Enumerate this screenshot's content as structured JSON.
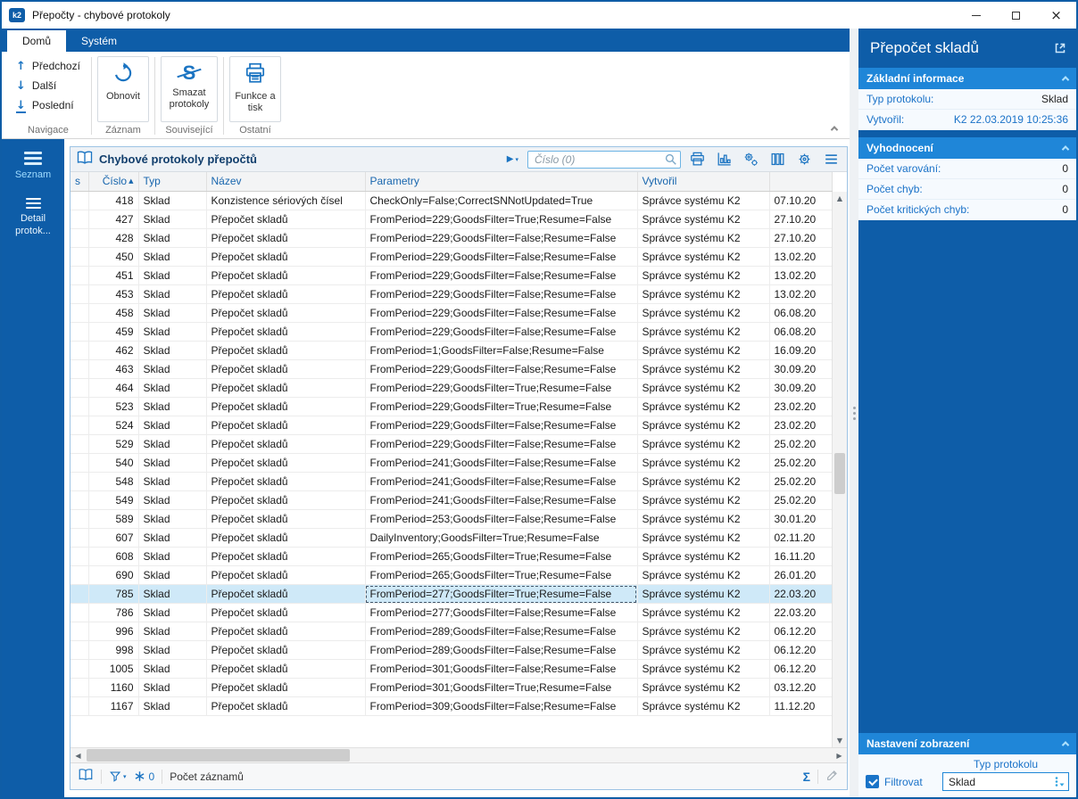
{
  "window": {
    "title": "Přepočty - chybové protokoly",
    "app_badge": "k2"
  },
  "glyphs": {
    "minimize": "",
    "close": "×",
    "play": "▶",
    "caret_down": "▾",
    "up": "↑",
    "down": "↓",
    "sort_asc": "▲",
    "scroll_up": "▲",
    "scroll_down": "▼",
    "scroll_left": "◀",
    "scroll_right": "▶",
    "sigma": "Σ"
  },
  "ribbon": {
    "tabs": [
      {
        "label": "Domů"
      },
      {
        "label": "Systém"
      }
    ],
    "nav": [
      {
        "label": "Předchozí"
      },
      {
        "label": "Další"
      },
      {
        "label": "Poslední"
      }
    ],
    "refresh_label": "Obnovit",
    "delete_label": "Smazat protokoly",
    "functions_label": "Funkce a tisk",
    "group_labels": [
      "Navigace",
      "Záznam",
      "Související",
      "Ostatní"
    ]
  },
  "sidebar": {
    "items": [
      {
        "label": "Seznam"
      },
      {
        "label": "Detail protok..."
      }
    ]
  },
  "main": {
    "title": "Chybové protokoly přepočtů",
    "search_placeholder": "Číslo (0)",
    "columns": {
      "s": "s",
      "cislo": "Číslo",
      "typ": "Typ",
      "nazev": "Název",
      "parametry": "Parametry",
      "vytvoril": "Vytvořil",
      "last": ""
    },
    "selected_num": "785",
    "rows": [
      [
        "418",
        "Sklad",
        "Konzistence sériových čísel",
        "CheckOnly=False;CorrectSNNotUpdated=True",
        "Správce systému K2",
        "07.10.20"
      ],
      [
        "427",
        "Sklad",
        "Přepočet skladů",
        "FromPeriod=229;GoodsFilter=True;Resume=False",
        "Správce systému K2",
        "27.10.20"
      ],
      [
        "428",
        "Sklad",
        "Přepočet skladů",
        "FromPeriod=229;GoodsFilter=False;Resume=False",
        "Správce systému K2",
        "27.10.20"
      ],
      [
        "450",
        "Sklad",
        "Přepočet skladů",
        "FromPeriod=229;GoodsFilter=False;Resume=False",
        "Správce systému K2",
        "13.02.20"
      ],
      [
        "451",
        "Sklad",
        "Přepočet skladů",
        "FromPeriod=229;GoodsFilter=False;Resume=False",
        "Správce systému K2",
        "13.02.20"
      ],
      [
        "453",
        "Sklad",
        "Přepočet skladů",
        "FromPeriod=229;GoodsFilter=False;Resume=False",
        "Správce systému K2",
        "13.02.20"
      ],
      [
        "458",
        "Sklad",
        "Přepočet skladů",
        "FromPeriod=229;GoodsFilter=False;Resume=False",
        "Správce systému K2",
        "06.08.20"
      ],
      [
        "459",
        "Sklad",
        "Přepočet skladů",
        "FromPeriod=229;GoodsFilter=False;Resume=False",
        "Správce systému K2",
        "06.08.20"
      ],
      [
        "462",
        "Sklad",
        "Přepočet skladů",
        "FromPeriod=1;GoodsFilter=False;Resume=False",
        "Správce systému K2",
        "16.09.20"
      ],
      [
        "463",
        "Sklad",
        "Přepočet skladů",
        "FromPeriod=229;GoodsFilter=False;Resume=False",
        "Správce systému K2",
        "30.09.20"
      ],
      [
        "464",
        "Sklad",
        "Přepočet skladů",
        "FromPeriod=229;GoodsFilter=True;Resume=False",
        "Správce systému K2",
        "30.09.20"
      ],
      [
        "523",
        "Sklad",
        "Přepočet skladů",
        "FromPeriod=229;GoodsFilter=True;Resume=False",
        "Správce systému K2",
        "23.02.20"
      ],
      [
        "524",
        "Sklad",
        "Přepočet skladů",
        "FromPeriod=229;GoodsFilter=False;Resume=False",
        "Správce systému K2",
        "23.02.20"
      ],
      [
        "529",
        "Sklad",
        "Přepočet skladů",
        "FromPeriod=229;GoodsFilter=False;Resume=False",
        "Správce systému K2",
        "25.02.20"
      ],
      [
        "540",
        "Sklad",
        "Přepočet skladů",
        "FromPeriod=241;GoodsFilter=False;Resume=False",
        "Správce systému K2",
        "25.02.20"
      ],
      [
        "548",
        "Sklad",
        "Přepočet skladů",
        "FromPeriod=241;GoodsFilter=False;Resume=False",
        "Správce systému K2",
        "25.02.20"
      ],
      [
        "549",
        "Sklad",
        "Přepočet skladů",
        "FromPeriod=241;GoodsFilter=False;Resume=False",
        "Správce systému K2",
        "25.02.20"
      ],
      [
        "589",
        "Sklad",
        "Přepočet skladů",
        "FromPeriod=253;GoodsFilter=False;Resume=False",
        "Správce systému K2",
        "30.01.20"
      ],
      [
        "607",
        "Sklad",
        "Přepočet skladů",
        "DailyInventory;GoodsFilter=True;Resume=False",
        "Správce systému K2",
        "02.11.20"
      ],
      [
        "608",
        "Sklad",
        "Přepočet skladů",
        "FromPeriod=265;GoodsFilter=True;Resume=False",
        "Správce systému K2",
        "16.11.20"
      ],
      [
        "690",
        "Sklad",
        "Přepočet skladů",
        "FromPeriod=265;GoodsFilter=True;Resume=False",
        "Správce systému K2",
        "26.01.20"
      ],
      [
        "785",
        "Sklad",
        "Přepočet skladů",
        "FromPeriod=277;GoodsFilter=True;Resume=False",
        "Správce systému K2",
        "22.03.20"
      ],
      [
        "786",
        "Sklad",
        "Přepočet skladů",
        "FromPeriod=277;GoodsFilter=False;Resume=False",
        "Správce systému K2",
        "22.03.20"
      ],
      [
        "996",
        "Sklad",
        "Přepočet skladů",
        "FromPeriod=289;GoodsFilter=False;Resume=False",
        "Správce systému K2",
        "06.12.20"
      ],
      [
        "998",
        "Sklad",
        "Přepočet skladů",
        "FromPeriod=289;GoodsFilter=False;Resume=False",
        "Správce systému K2",
        "06.12.20"
      ],
      [
        "1005",
        "Sklad",
        "Přepočet skladů",
        "FromPeriod=301;GoodsFilter=False;Resume=False",
        "Správce systému K2",
        "06.12.20"
      ],
      [
        "1160",
        "Sklad",
        "Přepočet skladů",
        "FromPeriod=301;GoodsFilter=True;Resume=False",
        "Správce systému K2",
        "03.12.20"
      ],
      [
        "1167",
        "Sklad",
        "Přepočet skladů",
        "FromPeriod=309;GoodsFilter=False;Resume=False",
        "Správce systému K2",
        "11.12.20"
      ]
    ],
    "status": {
      "filter_count": "0",
      "records_label": "Počet záznamů"
    }
  },
  "panel": {
    "title": "Přepočet skladů",
    "basic": {
      "header": "Základní informace",
      "rows": [
        {
          "label": "Typ protokolu:",
          "value": "Sklad"
        },
        {
          "label": "Vytvořil:",
          "value": "K2 22.03.2019 10:25:36"
        }
      ]
    },
    "evaluation": {
      "header": "Vyhodnocení",
      "rows": [
        {
          "label": "Počet varování:",
          "value": "0"
        },
        {
          "label": "Počet chyb:",
          "value": "0"
        },
        {
          "label": "Počet kritických chyb:",
          "value": "0"
        }
      ]
    },
    "settings": {
      "header": "Nastavení zobrazení",
      "field_label": "Typ protokolu",
      "filter_label": "Filtrovat",
      "filter_checked": true,
      "combo_value": "Sklad"
    }
  }
}
